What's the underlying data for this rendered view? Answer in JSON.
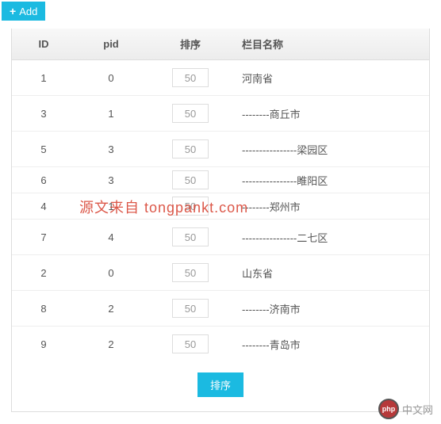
{
  "header": {
    "add_label": "Add"
  },
  "columns": {
    "id": "ID",
    "pid": "pid",
    "sort": "排序",
    "name": "栏目名称"
  },
  "rows": [
    {
      "id": "1",
      "pid": "0",
      "sort": "50",
      "name": "河南省"
    },
    {
      "id": "3",
      "pid": "1",
      "sort": "50",
      "name": "--------商丘市"
    },
    {
      "id": "5",
      "pid": "3",
      "sort": "50",
      "name": "----------------梁园区"
    },
    {
      "id": "6",
      "pid": "3",
      "sort": "50",
      "name": "----------------睢阳区"
    },
    {
      "id": "4",
      "pid": "1",
      "sort": "50",
      "name": "--------郑州市"
    },
    {
      "id": "7",
      "pid": "4",
      "sort": "50",
      "name": "----------------二七区"
    },
    {
      "id": "2",
      "pid": "0",
      "sort": "50",
      "name": "山东省"
    },
    {
      "id": "8",
      "pid": "2",
      "sort": "50",
      "name": "--------济南市"
    },
    {
      "id": "9",
      "pid": "2",
      "sort": "50",
      "name": "--------青岛市"
    }
  ],
  "footer": {
    "sort_button": "排序"
  },
  "watermark": "源文来自 tongpankt.com",
  "logo": {
    "badge": "php",
    "text": "中文网"
  }
}
